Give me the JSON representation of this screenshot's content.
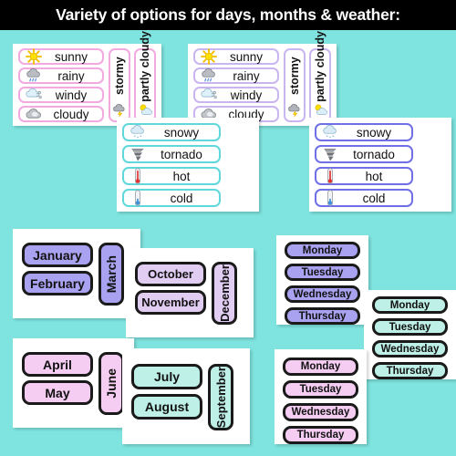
{
  "header": {
    "title": "Variety of options for days, months & weather:"
  },
  "colors": {
    "background": "#7FE4DF",
    "header_bg": "#000000",
    "header_text": "#FFFFFF",
    "border_pink": "#F2A9E0",
    "border_lavender": "#C9B6F0",
    "border_cyan": "#5FD8DC",
    "border_blue": "#6F6FE8",
    "fill_purple": "#A9A2F0",
    "fill_lavender": "#E2CDF2",
    "fill_pink": "#F5CDF2",
    "fill_mint": "#BFF0E8"
  },
  "weather": {
    "set_pink": {
      "border_color": "#F2A9E0",
      "rows": [
        {
          "label": "sunny",
          "icon": "sun-icon"
        },
        {
          "label": "rainy",
          "icon": "rain-cloud-icon"
        },
        {
          "label": "windy",
          "icon": "wind-cloud-icon"
        },
        {
          "label": "cloudy",
          "icon": "cloud-icon"
        }
      ],
      "vertical": [
        {
          "label": "stormy",
          "icon": "storm-cloud-icon"
        },
        {
          "label": "partly cloudy",
          "icon": "sun-cloud-icon"
        }
      ]
    },
    "set_lavender": {
      "border_color": "#C9B6F0",
      "rows": [
        {
          "label": "sunny",
          "icon": "sun-icon"
        },
        {
          "label": "rainy",
          "icon": "rain-cloud-icon"
        },
        {
          "label": "windy",
          "icon": "wind-cloud-icon"
        },
        {
          "label": "cloudy",
          "icon": "cloud-icon"
        }
      ],
      "vertical": [
        {
          "label": "stormy",
          "icon": "storm-cloud-icon"
        },
        {
          "label": "partly cloudy",
          "icon": "sun-cloud-icon"
        }
      ]
    },
    "set_cyan": {
      "border_color": "#5FD8DC",
      "rows": [
        {
          "label": "snowy",
          "icon": "snow-cloud-icon"
        },
        {
          "label": "tornado",
          "icon": "tornado-icon"
        },
        {
          "label": "hot",
          "icon": "thermometer-hot-icon"
        },
        {
          "label": "cold",
          "icon": "thermometer-cold-icon"
        }
      ]
    },
    "set_blue": {
      "border_color": "#6F6FE8",
      "rows": [
        {
          "label": "snowy",
          "icon": "snow-cloud-icon"
        },
        {
          "label": "tornado",
          "icon": "tornado-icon"
        },
        {
          "label": "hot",
          "icon": "thermometer-hot-icon"
        },
        {
          "label": "cold",
          "icon": "thermometer-cold-icon"
        }
      ]
    }
  },
  "months": {
    "set_purple": {
      "fill": "#A9A2F0",
      "horizontal": [
        "January",
        "February"
      ],
      "vertical": [
        "March"
      ]
    },
    "set_lavender": {
      "fill": "#E2CDF2",
      "horizontal": [
        "October",
        "November"
      ],
      "vertical": [
        "December"
      ]
    },
    "set_pink": {
      "fill": "#F5CDF2",
      "horizontal": [
        "April",
        "May"
      ],
      "vertical": [
        "June"
      ]
    },
    "set_mint": {
      "fill": "#BFF0E8",
      "horizontal": [
        "July",
        "August"
      ],
      "vertical": [
        "September"
      ]
    }
  },
  "days": {
    "set_purple": {
      "fill": "#A9A2F0",
      "items": [
        "Monday",
        "Tuesday",
        "Wednesday",
        "Thursday"
      ]
    },
    "set_mint": {
      "fill": "#BFF0E8",
      "items": [
        "Monday",
        "Tuesday",
        "Wednesday",
        "Thursday"
      ]
    },
    "set_pink": {
      "fill": "#F5CDF2",
      "items": [
        "Monday",
        "Tuesday",
        "Wednesday",
        "Thursday"
      ]
    }
  }
}
